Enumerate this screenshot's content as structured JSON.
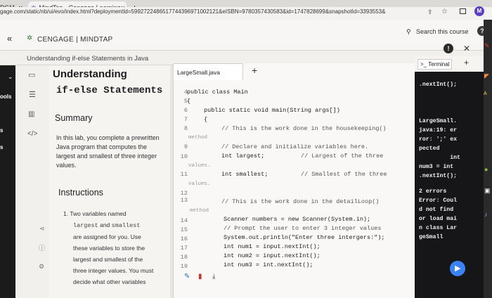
{
  "browser": {
    "tabs": [
      {
        "label": "DS11"
      },
      {
        "label": "MindTap - Cengage Learning"
      }
    ],
    "new_tab_symbol": "+",
    "url": "gage.com/static/nb/ui/evo/index.html?deploymentId=5992722486517744396971002121&eISBN=9780357430583&id=1747828699&snapshotId=3393553&",
    "profile_initial": "M"
  },
  "header": {
    "brand": "CENGAGE | MINDTAP",
    "search_placeholder": "Search this course",
    "breadcrumb": "Understanding if-else Statements in Java",
    "collapse_symbol": "«",
    "close_symbol": "✕"
  },
  "left_edge_labels": [
    "ools",
    "s",
    "s"
  ],
  "lesson": {
    "title_line1": "Understanding",
    "title_line2": "if-else Statements",
    "summary_heading": "Summary",
    "summary_text": "In this lab, you complete a prewritten Java program that computes the largest and smallest of three integer values.",
    "instructions_heading": "Instructions",
    "step1_prefix": "1. Two variables named",
    "step1_code1": "largest",
    "step1_and": "and",
    "step1_code2": "smallest",
    "step1_rest1": "are assigned for you. Use",
    "step1_rest2": "these variables to store the",
    "step1_rest3": "largest and smallest of the",
    "step1_rest4": "three integer values. You must",
    "step1_rest5": "decide what other variables"
  },
  "editor": {
    "file_tab": "LargeSmall.java",
    "add_tab": "+",
    "line_numbers": [
      "4",
      "5",
      "6",
      "7",
      "8",
      "9",
      "10",
      "11",
      "12",
      "13",
      "14",
      "15",
      "16",
      "17",
      "18",
      "19"
    ],
    "lines": {
      "l4": "public class Main",
      "l5": "{",
      "l6": "public static void main(String args[])",
      "l7": "{",
      "l8": "// This is the work done in the housekeeping()",
      "l8b": "method",
      "l9": "// Declare and initialize variables here.",
      "l10a": "int largest;",
      "l10b": "// Largest of the three",
      "l10c": "values.",
      "l11a": "int smallest;",
      "l11b": "// Smallest of the three",
      "l11c": "values.",
      "l13": "// This is the work done in the detailLoop()",
      "l13b": "method",
      "l14": "Scanner numbers = new Scanner(System.in);",
      "l15": "// Prompt the user to enter 3 integer values",
      "l16": "System.out.println(\"Enter three intergers:\");",
      "l17": "int num1 = input.nextInt();",
      "l18": "int num2 = input.nextInt();",
      "l19": "int num3 = int.nextInt();"
    }
  },
  "terminal": {
    "tab_label": ">_ Terminal",
    "add": "+",
    "lines": [
      ".nextInt();",
      "LargeSmall.",
      "java:19: er",
      "ror: ';' ex",
      "pected",
      "         int",
      "num3 = int",
      ".nextInt();",
      "2 errors",
      "Error: Coul",
      "d not find",
      "or load mai",
      "n class Lar",
      "geSmall"
    ]
  },
  "colors": {
    "accent_blue": "#1a73e8",
    "terminal_bg": "#161618",
    "play_button": "#3b82f6"
  }
}
